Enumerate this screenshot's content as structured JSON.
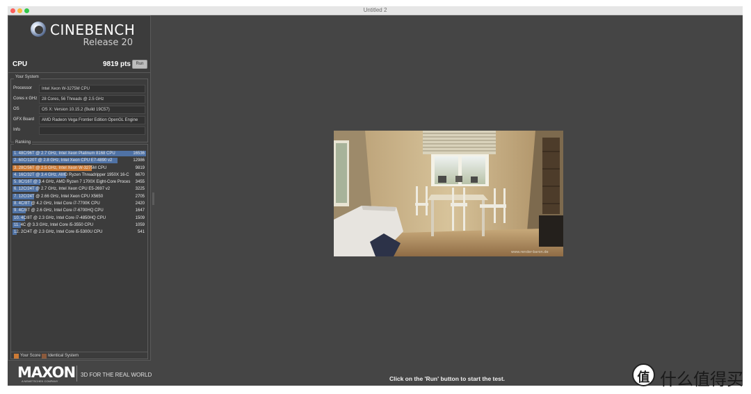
{
  "window": {
    "title": "Untitled 2"
  },
  "header": {
    "logo_text": "CINEBENCH",
    "release": "Release 20"
  },
  "cpu": {
    "label": "CPU",
    "score": "9819 pts",
    "run_label": "Run"
  },
  "your_system": {
    "title": "Your System",
    "rows": [
      {
        "label": "Processor",
        "value": "Intel Xeon W-3275M CPU"
      },
      {
        "label": "Cores x GHz",
        "value": "28 Cores, 56 Threads @ 2.5 GHz"
      },
      {
        "label": "OS",
        "value": "OS X: Version 10.15.2 (Build 19C57)"
      },
      {
        "label": "GFX Board",
        "value": "AMD Radeon Vega Frontier Edition OpenGL Engine"
      },
      {
        "label": "Info",
        "value": ""
      }
    ]
  },
  "ranking": {
    "title": "Ranking",
    "items": [
      {
        "text": "1. 48C/96T @ 2.7 GHz, Intel Xeon Platinum 8168 CPU",
        "score": 16536,
        "is_yours": false
      },
      {
        "text": "2. 60C/120T @ 2.8 GHz, Intel Xeon CPU E7-4890 v2",
        "score": 12986,
        "is_yours": false
      },
      {
        "text": "3. 28C/56T @ 2.5 GHz, Intel Xeon W-3275M CPU",
        "score": 9819,
        "is_yours": true
      },
      {
        "text": "4. 16C/32T @ 3.4 GHz, AMD Ryzen Threadripper 1950X 16-C",
        "score": 6670,
        "is_yours": false
      },
      {
        "text": "5. 8C/16T @ 3.4 GHz, AMD Ryzen 7 1700X Eight-Core Proces",
        "score": 3455,
        "is_yours": false
      },
      {
        "text": "6. 12C/24T @ 2.7 GHz, Intel Xeon CPU E5-2697 v2",
        "score": 3225,
        "is_yours": false
      },
      {
        "text": "7. 12C/24T @ 2.66 GHz, Intel Xeon CPU X5650",
        "score": 2705,
        "is_yours": false
      },
      {
        "text": "8. 4C/8T @ 4.2 GHz, Intel Core i7-7700K CPU",
        "score": 2420,
        "is_yours": false
      },
      {
        "text": "9. 4C/8T @ 2.6 GHz, Intel Core i7-6700HQ CPU",
        "score": 1647,
        "is_yours": false
      },
      {
        "text": "10. 4C/8T @ 2.3 GHz, Intel Core i7-4850HQ CPU",
        "score": 1509,
        "is_yours": false
      },
      {
        "text": "11. 4C @ 3.3 GHz, Intel Core i5-3550 CPU",
        "score": 1059,
        "is_yours": false
      },
      {
        "text": "12. 2C/4T @ 2.3 GHz, Intel Core i5-5300U CPU",
        "score": 541,
        "is_yours": false
      }
    ],
    "max_score": 16536,
    "legend": {
      "your_score": "Your Score",
      "identical_system": "Identical System"
    }
  },
  "brand": {
    "logo": "MAXON",
    "sub": "A NEMETSCHEK COMPANY",
    "tagline": "3D FOR THE REAL WORLD"
  },
  "status": {
    "message": "Click on the 'Run' button to start the test."
  },
  "watermark": {
    "badge": "值",
    "text": "什么值得买"
  },
  "colors": {
    "bar": "#4f72a5",
    "your_score": "#cc7a35",
    "identical_system": "#8b5a3c",
    "background": "#454545",
    "panel": "#3c3c3c"
  },
  "icons": [
    "cinebench-sphere-icon",
    "close-icon",
    "minimize-icon",
    "maximize-icon"
  ]
}
